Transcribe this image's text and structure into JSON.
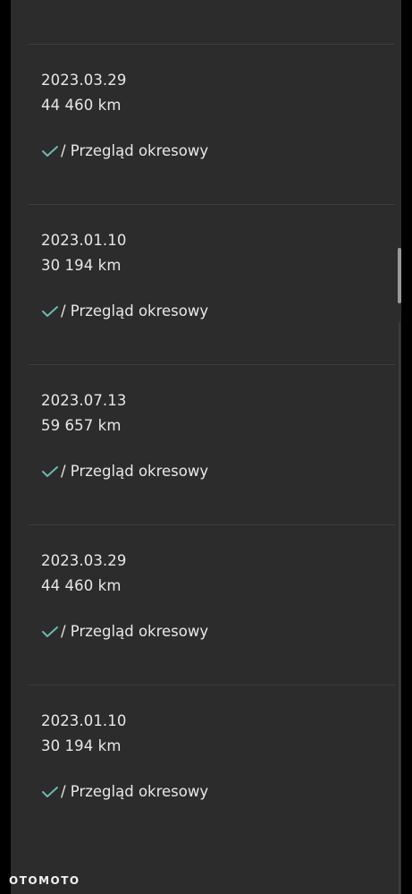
{
  "entries": [
    {
      "date": "2023.03.29",
      "mileage": "44 460 km",
      "status_label": "/ Przegląd okresowy",
      "status_icon": "check-icon"
    },
    {
      "date": "2023.01.10",
      "mileage": "30 194 km",
      "status_label": "/ Przegląd okresowy",
      "status_icon": "check-icon"
    },
    {
      "date": "2023.07.13",
      "mileage": "59 657 km",
      "status_label": "/ Przegląd okresowy",
      "status_icon": "check-icon"
    },
    {
      "date": "2023.03.29",
      "mileage": "44 460 km",
      "status_label": "/ Przegląd okresowy",
      "status_icon": "check-icon"
    },
    {
      "date": "2023.01.10",
      "mileage": "30 194 km",
      "status_label": "/ Przegląd okresowy",
      "status_icon": "check-icon"
    }
  ],
  "watermark": "OTOMOTO",
  "colors": {
    "background": "#2c2c2c",
    "text": "#e8e8e8",
    "check": "#6fb7b0",
    "divider": "#3a3f44"
  }
}
